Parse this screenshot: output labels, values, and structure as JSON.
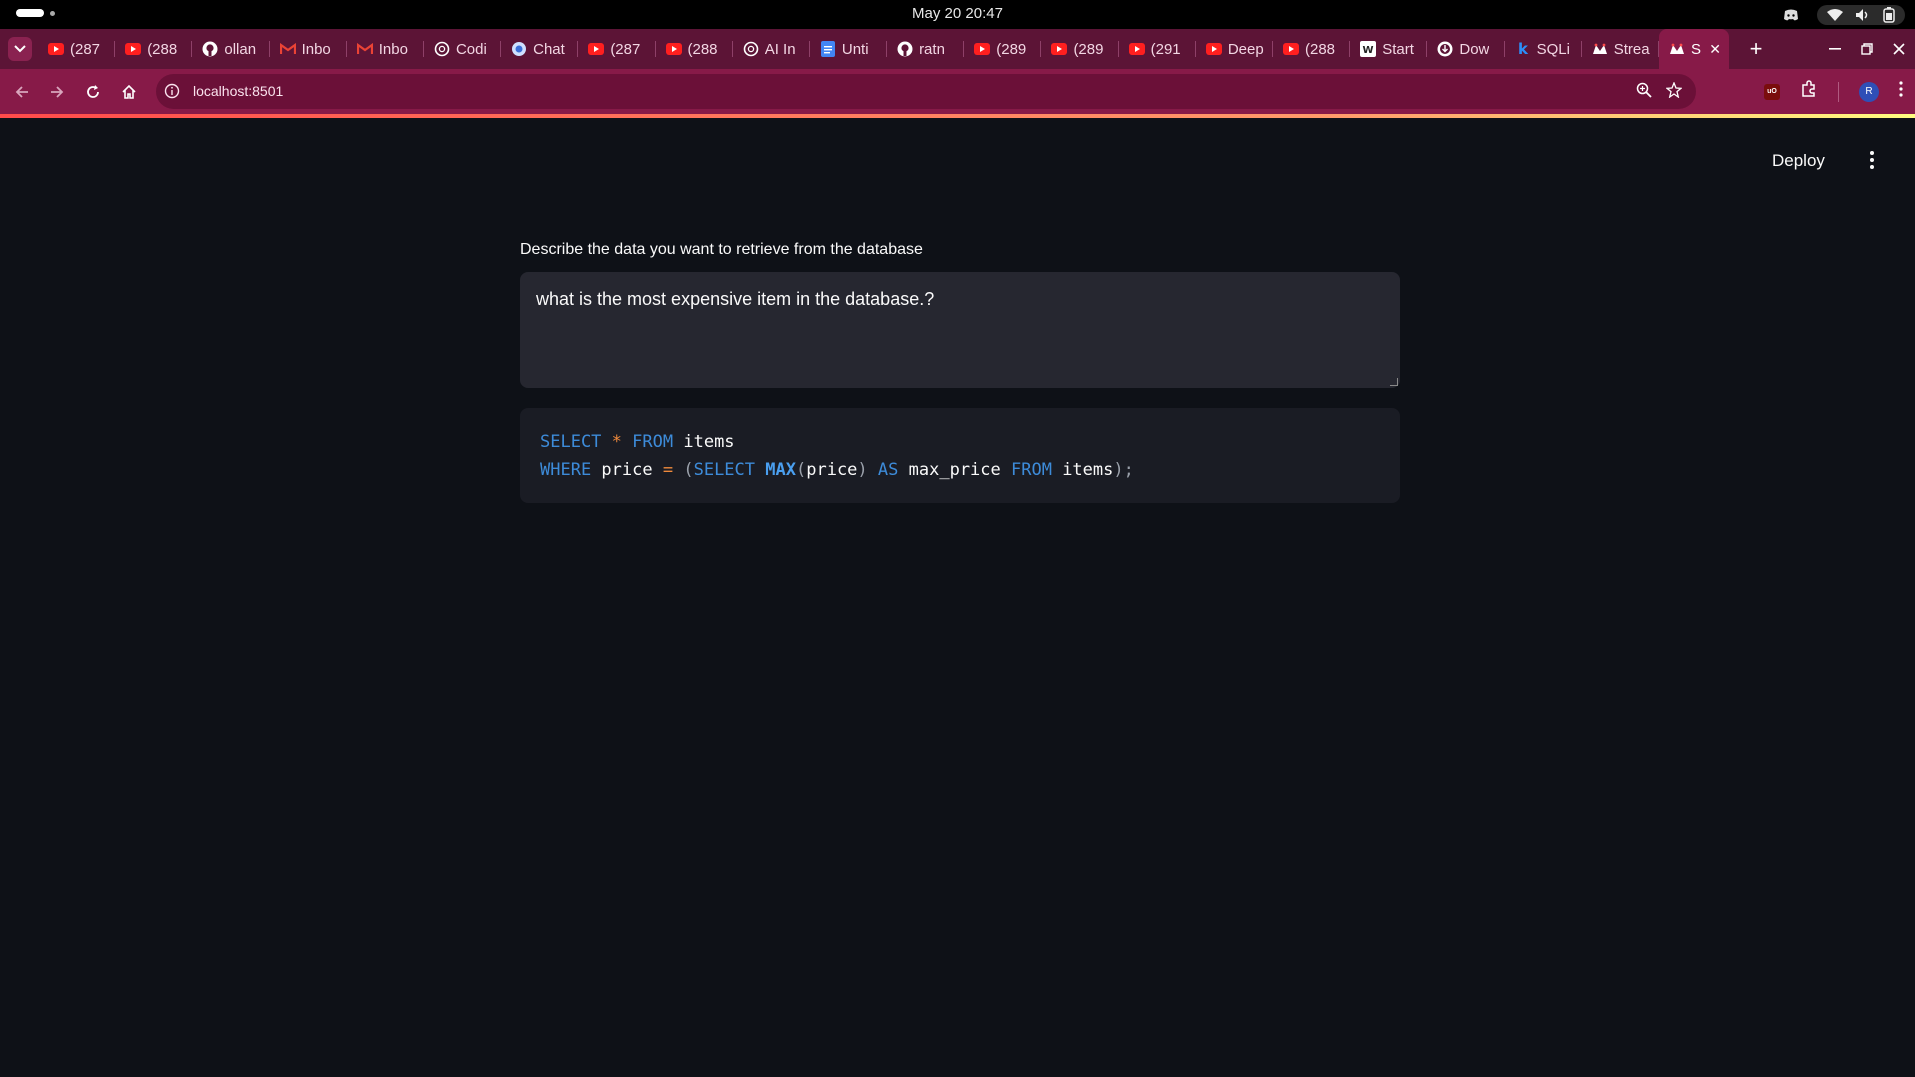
{
  "os": {
    "clock": "May 20  20:47"
  },
  "tabs": [
    {
      "icon": "youtube-icon",
      "title": "(287"
    },
    {
      "icon": "youtube-icon",
      "title": "(288"
    },
    {
      "icon": "github-icon",
      "title": "ollan"
    },
    {
      "icon": "gmail-icon",
      "title": "Inbo"
    },
    {
      "icon": "gmail-icon",
      "title": "Inbo"
    },
    {
      "icon": "openai-icon",
      "title": "Codi"
    },
    {
      "icon": "chat-icon",
      "title": "Chat"
    },
    {
      "icon": "youtube-icon",
      "title": "(287"
    },
    {
      "icon": "youtube-icon",
      "title": "(288"
    },
    {
      "icon": "openai-icon",
      "title": "AI In"
    },
    {
      "icon": "docs-icon",
      "title": "Unti"
    },
    {
      "icon": "github-icon",
      "title": "ratn"
    },
    {
      "icon": "youtube-icon",
      "title": "(289"
    },
    {
      "icon": "youtube-icon",
      "title": "(289"
    },
    {
      "icon": "youtube-icon",
      "title": "(291"
    },
    {
      "icon": "youtube-icon",
      "title": "Deep"
    },
    {
      "icon": "youtube-icon",
      "title": "(288"
    },
    {
      "icon": "w-icon",
      "title": "Start"
    },
    {
      "icon": "download-icon",
      "title": "Dow"
    },
    {
      "icon": "k-icon",
      "title": "SQLi"
    },
    {
      "icon": "streamlit-icon",
      "title": "Strea"
    },
    {
      "icon": "streamlit-icon",
      "title": "S",
      "active": true
    }
  ],
  "toolbar": {
    "url": "localhost:8501",
    "avatar_letter": "R",
    "ext_label": "uO"
  },
  "app": {
    "deploy_label": "Deploy",
    "prompt_label": "Describe the data you want to retrieve from the database",
    "prompt_value": "what is the most expensive item in the database.?",
    "sql_query": "SELECT * FROM items\nWHERE price = (SELECT MAX(price) AS max_price FROM items);"
  },
  "colors": {
    "app_bg": "#0e1117",
    "input_bg": "#262730",
    "code_bg": "#1a1c24",
    "tabstrip_bg": "#5c1436",
    "toolbar_bg": "#871a48",
    "sql_keyword": "#3d8bd9",
    "sql_operator": "#f08a3c"
  }
}
